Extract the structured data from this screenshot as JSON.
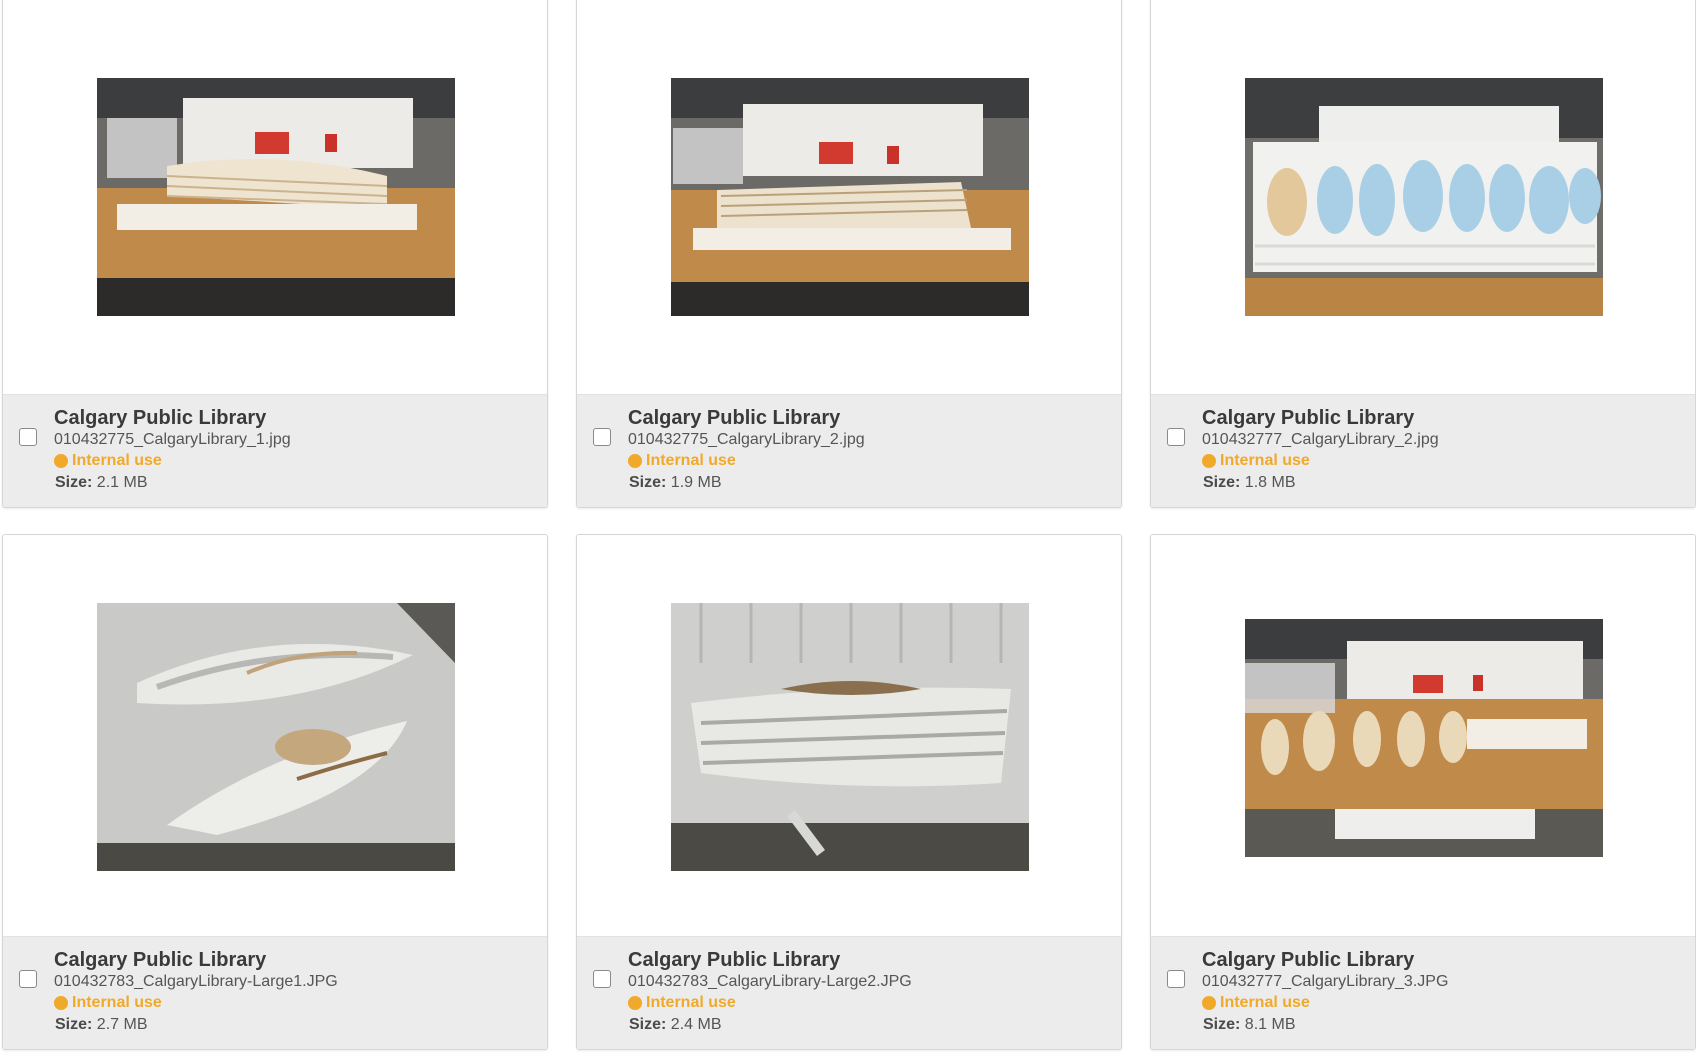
{
  "colors": {
    "status_internal": "#f0a92a",
    "card_meta_bg": "#ececec",
    "card_border": "#d6d6d6"
  },
  "size_label": "Size:",
  "assets": [
    {
      "title": "Calgary Public Library",
      "filename": "010432775_CalgaryLibrary_1.jpg",
      "status": "Internal use",
      "size": "2.1 MB",
      "checked": false,
      "image_icon": "architectural-model-photo"
    },
    {
      "title": "Calgary Public Library",
      "filename": "010432775_CalgaryLibrary_2.jpg",
      "status": "Internal use",
      "size": "1.9 MB",
      "checked": false,
      "image_icon": "architectural-model-photo"
    },
    {
      "title": "Calgary Public Library",
      "filename": "010432777_CalgaryLibrary_2.jpg",
      "status": "Internal use",
      "size": "1.8 MB",
      "checked": false,
      "image_icon": "architectural-model-photo"
    },
    {
      "title": "Calgary Public Library",
      "filename": "010432783_CalgaryLibrary-Large1.JPG",
      "status": "Internal use",
      "size": "2.7 MB",
      "checked": false,
      "image_icon": "architectural-model-photo"
    },
    {
      "title": "Calgary Public Library",
      "filename": "010432783_CalgaryLibrary-Large2.JPG",
      "status": "Internal use",
      "size": "2.4 MB",
      "checked": false,
      "image_icon": "architectural-model-photo"
    },
    {
      "title": "Calgary Public Library",
      "filename": "010432777_CalgaryLibrary_3.JPG",
      "status": "Internal use",
      "size": "8.1 MB",
      "checked": false,
      "image_icon": "architectural-model-photo"
    }
  ]
}
